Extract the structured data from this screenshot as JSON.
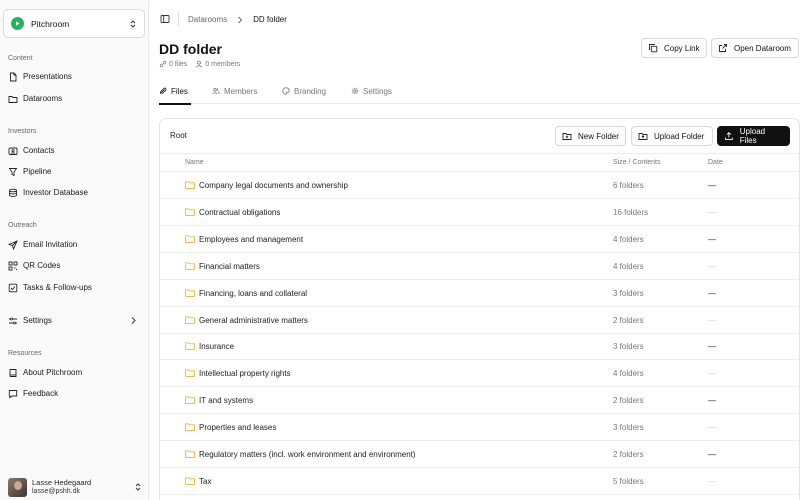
{
  "app": {
    "name": "Pitchroom"
  },
  "sidebar": {
    "sections": [
      {
        "label": "Content"
      },
      {
        "label": "Investors"
      },
      {
        "label": "Outreach"
      },
      {
        "label": "Resources"
      }
    ],
    "items": [
      {
        "label": "Presentations",
        "icon": "file-icon"
      },
      {
        "label": "Datarooms",
        "icon": "folder-icon"
      },
      {
        "label": "Contacts",
        "icon": "id-card-icon"
      },
      {
        "label": "Pipeline",
        "icon": "filter-icon"
      },
      {
        "label": "Investor Database",
        "icon": "database-icon"
      },
      {
        "label": "Email Invitation",
        "icon": "send-icon"
      },
      {
        "label": "QR Codes",
        "icon": "qr-code-icon"
      },
      {
        "label": "Tasks & Follow-ups",
        "icon": "checkbox-icon"
      },
      {
        "label": "Settings",
        "icon": "sliders-icon"
      },
      {
        "label": "About Pitchroom",
        "icon": "book-icon"
      },
      {
        "label": "Feedback",
        "icon": "message-icon"
      }
    ]
  },
  "user": {
    "name": "Lasse Hedegaard",
    "email": "lasse@pshh.dk"
  },
  "breadcrumb": {
    "parent": "Datarooms",
    "current": "DD folder"
  },
  "page": {
    "title": "DD folder",
    "files_count": "0 files",
    "members_count": "0 members"
  },
  "actions": {
    "copy_link": "Copy Link",
    "open_dataroom": "Open Dataroom"
  },
  "tabs": [
    {
      "label": "Files"
    },
    {
      "label": "Members"
    },
    {
      "label": "Branding"
    },
    {
      "label": "Settings"
    }
  ],
  "files": {
    "root_label": "Root",
    "new_folder": "New Folder",
    "upload_folder": "Upload Folder",
    "upload_files": "Upload Files",
    "columns": {
      "name": "Name",
      "size": "Size / Contents",
      "date": "Date"
    },
    "rows": [
      {
        "name": "Company legal documents and ownership",
        "size": "6 folders",
        "date": "—"
      },
      {
        "name": "Contractual obligations",
        "size": "16 folders",
        "date": "—"
      },
      {
        "name": "Employees and management",
        "size": "4 folders",
        "date": "—"
      },
      {
        "name": "Financial matters",
        "size": "4 folders",
        "date": "—"
      },
      {
        "name": "Financing, loans and collateral",
        "size": "3 folders",
        "date": "—"
      },
      {
        "name": "General administrative matters",
        "size": "2 folders",
        "date": "—"
      },
      {
        "name": "Insurance",
        "size": "3 folders",
        "date": "—"
      },
      {
        "name": "Intellectual property rights",
        "size": "4 folders",
        "date": "—"
      },
      {
        "name": "IT and systems",
        "size": "2 folders",
        "date": "—"
      },
      {
        "name": "Properties and leases",
        "size": "3 folders",
        "date": "—"
      },
      {
        "name": "Regulatory matters (incl. work environment and environment)",
        "size": "2 folders",
        "date": "—"
      },
      {
        "name": "Tax",
        "size": "5 folders",
        "date": "—"
      }
    ]
  },
  "colors": {
    "brand": "#22b45e",
    "folder": "#f2b33d",
    "primary_button": "#111111"
  }
}
